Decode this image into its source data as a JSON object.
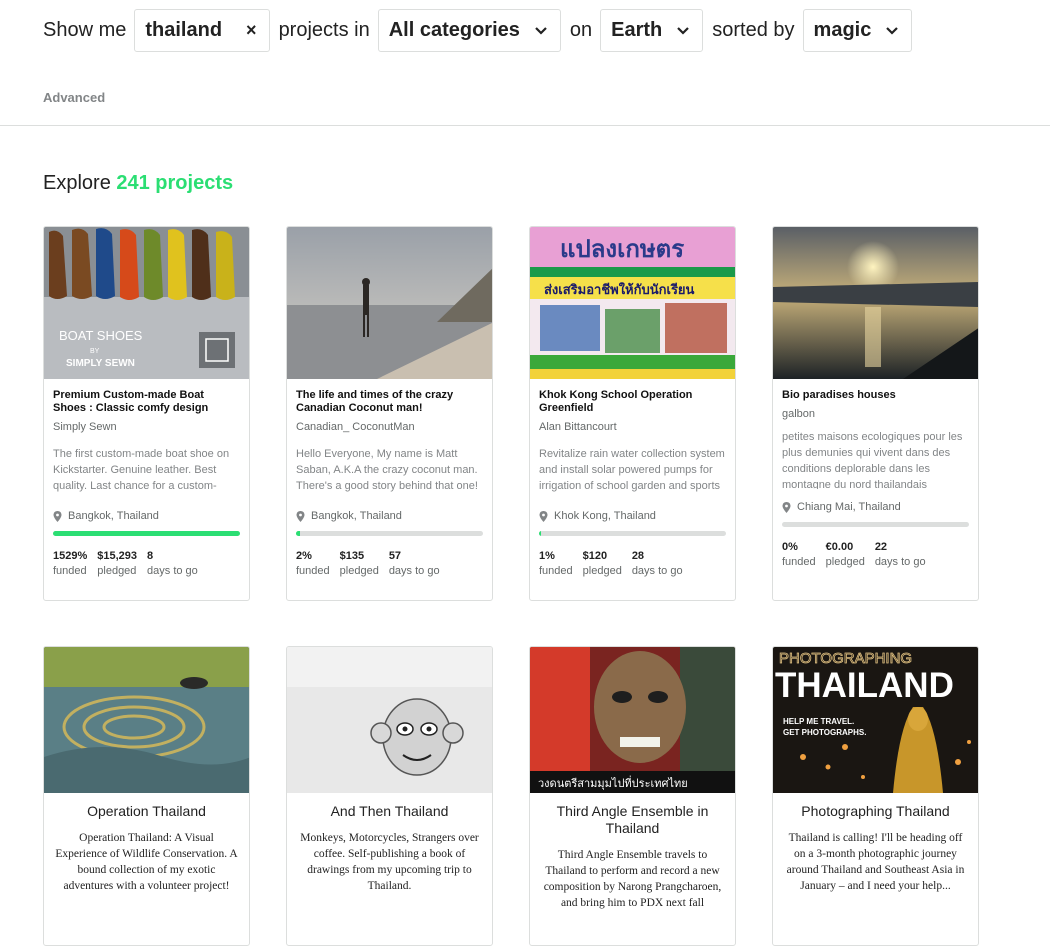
{
  "filter": {
    "prefix": "Show me",
    "search_value": "thailand",
    "mid1": "projects in",
    "category": "All categories",
    "mid2": "on",
    "location": "Earth",
    "mid3": "sorted by",
    "sort": "magic",
    "advanced": "Advanced"
  },
  "explore": {
    "label": "Explore",
    "count": "241 projects"
  },
  "colors": {
    "accent": "#2bde73",
    "border": "#dcdedd"
  },
  "projects": [
    {
      "title": "Premium Custom-made Boat Shoes : Classic comfy design",
      "creator": "Simply Sewn",
      "blurb": "The first custom-made boat shoe on Kickstarter. Genuine leather. Best quality. Last chance for a custom-made before getting in stores.",
      "location": "Bangkok, Thailand",
      "funded": "1529%",
      "pledged": "$15,293",
      "days": "8",
      "percent": 100,
      "thumb_text1": "BOAT SHOES",
      "thumb_text2": "BY",
      "thumb_text3": "SIMPLY SEWN"
    },
    {
      "title": "The life and times of the crazy Canadian Coconut man!",
      "creator": "Canadian_ CoconutMan",
      "blurb": "Hello Everyone, My name is Matt Saban, A.K.A the crazy coconut man. There's a good story behind that one! ;)",
      "location": "Bangkok, Thailand",
      "funded": "2%",
      "pledged": "$135",
      "days": "57",
      "percent": 2
    },
    {
      "title": "Khok Kong School Operation Greenfield",
      "creator": "Alan Bittancourt",
      "blurb": "Revitalize rain water collection system and install solar powered pumps for irrigation of school garden and sports fields",
      "location": "Khok Kong, Thailand",
      "funded": "1%",
      "pledged": "$120",
      "days": "28",
      "percent": 1,
      "thumb_text1": "แปลงเกษตร",
      "thumb_text2": "ส่งเสริมอาชีพให้กับนักเรียน"
    },
    {
      "title": "Bio paradises houses",
      "creator": "galbon",
      "blurb": "petites maisons ecologiques pour les plus demunies qui vivent dans des conditions deplorable dans les montagne du nord thailandais",
      "location": "Chiang Mai, Thailand",
      "funded": "0%",
      "pledged": "€0.00",
      "days": "22",
      "percent": 0
    }
  ],
  "stat_labels": {
    "funded": "funded",
    "pledged": "pledged",
    "days": "days to go"
  },
  "books": [
    {
      "title": "Operation Thailand",
      "blurb": "Operation Thailand: A Visual Experience of Wildlife Conservation. A bound collection of my exotic adventures with a volunteer project!"
    },
    {
      "title": "And Then Thailand",
      "blurb": "Monkeys, Motorcycles, Strangers over coffee. Self-publishing a book of drawings from my upcoming trip to Thailand."
    },
    {
      "title": "Third Angle Ensemble in Thailand",
      "blurb": "Third Angle Ensemble travels to Thailand to perform and record a new composition by Narong Prangcharoen, and bring him to PDX next fall",
      "thumb_text1": "วงดนตรีสามมุมไปที่ประเทศไทย"
    },
    {
      "title": "Photographing Thailand",
      "blurb": "Thailand is calling! I'll be heading off on a 3-month photographic journey around Thailand and Southeast Asia in January – and I need your help...",
      "thumb_text1": "PHOTOGRAPHING",
      "thumb_text2": "THAILAND",
      "thumb_text3": "HELP ME TRAVEL.",
      "thumb_text4": "GET PHOTOGRAPHS."
    }
  ]
}
